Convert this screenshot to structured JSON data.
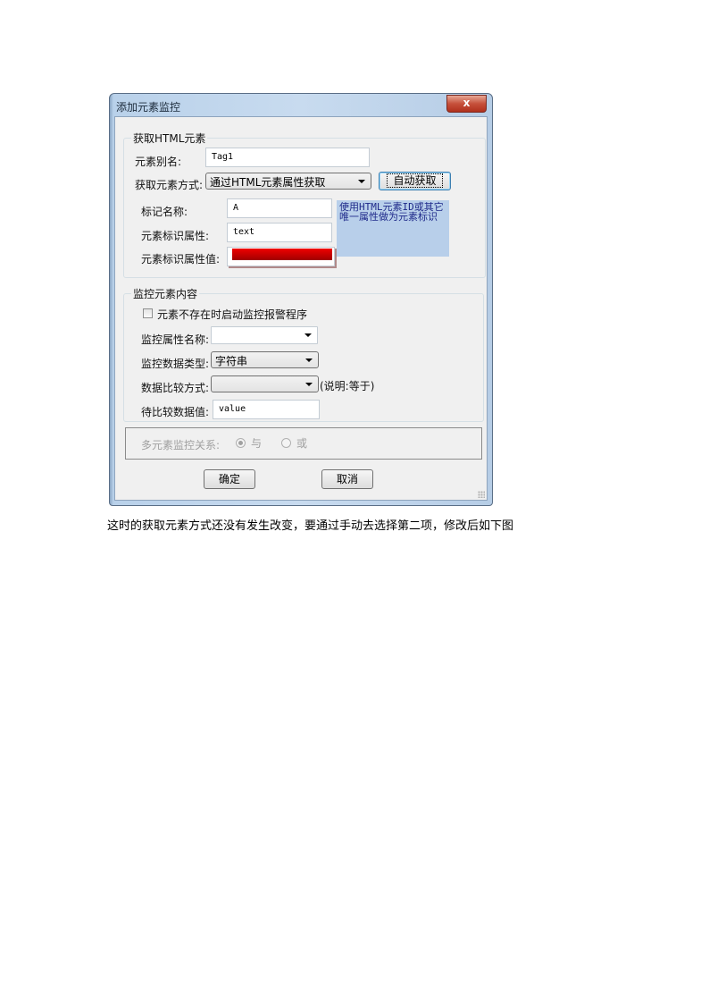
{
  "dialog": {
    "title": "添加元素监控",
    "close_label": "x",
    "group_get": {
      "title": "获取HTML元素",
      "alias_label": "元素别名:",
      "alias_value": "Tag1",
      "method_label": "获取元素方式:",
      "method_value": "通过HTML元素属性获取",
      "auto_button": "自动获取",
      "tag_name_label": "标记名称:",
      "tag_name_value": "A",
      "id_attr_label": "元素标识属性:",
      "id_attr_value": "text",
      "id_attr_value_label": "元素标识属性值:",
      "id_attr_value_value": "",
      "note": "使用HTML元素ID或其它唯一属性做为元素标识"
    },
    "group_monitor": {
      "title": "监控元素内容",
      "checkbox_label": "元素不存在时启动监控报警程序",
      "checkbox_checked": false,
      "attr_name_label": "监控属性名称:",
      "attr_name_value": "",
      "data_type_label": "监控数据类型:",
      "data_type_value": "字符串",
      "compare_label": "数据比较方式:",
      "compare_value": "",
      "compare_note": "(说明:等于)",
      "compare_data_label": "待比较数据值:",
      "compare_data_value": "value"
    },
    "relation": {
      "label": "多元素监控关系:",
      "options": [
        {
          "label": "与",
          "selected": true
        },
        {
          "label": "或",
          "selected": false
        }
      ]
    },
    "ok_button": "确定",
    "cancel_button": "取消"
  },
  "caption": "这时的获取元素方式还没有发生改变，要通过手动去选择第二项，修改后如下图",
  "colors": {
    "highlight_red": "#e00000",
    "note_bg": "#b8cfea",
    "close_red": "#c6503b"
  }
}
